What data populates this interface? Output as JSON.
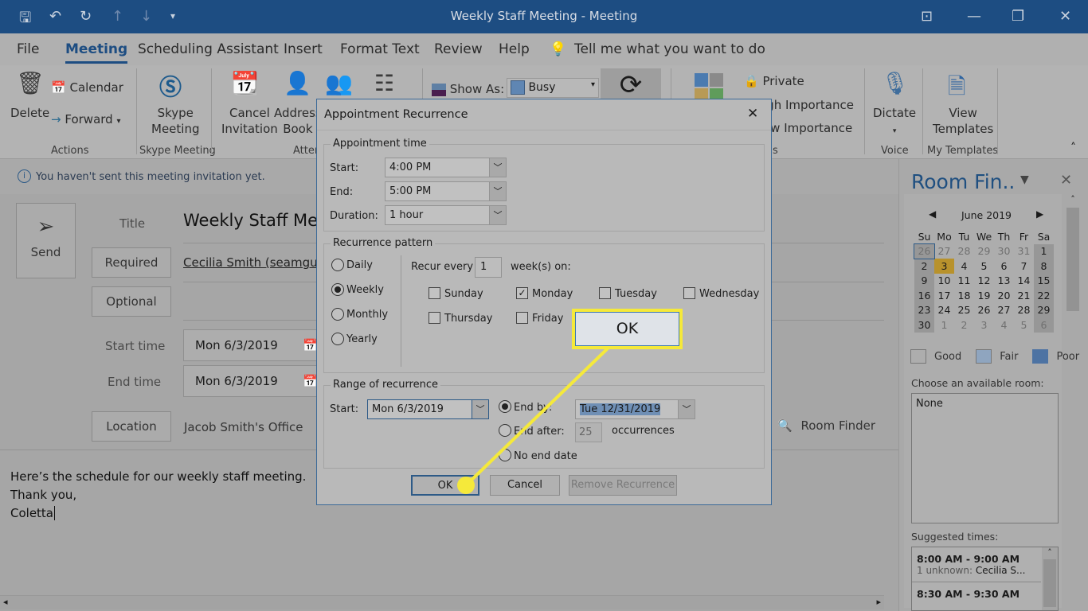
{
  "window": {
    "title": "Weekly Staff Meeting  -  Meeting"
  },
  "menu": [
    "File",
    "Meeting",
    "Scheduling Assistant",
    "Insert",
    "Format Text",
    "Review",
    "Help"
  ],
  "tell_me": "Tell me what you want to do",
  "ribbon": {
    "delete": "Delete",
    "calendar": "Calendar",
    "forward": "Forward",
    "actions": "Actions",
    "skype1": "Skype",
    "skype2": "Meeting",
    "skype_group": "Skype Meeting",
    "cancel1": "Cancel",
    "cancel2": "Invitation",
    "address1": "Address",
    "address2": "Book",
    "attendees_group": "Atten",
    "show_as": "Show As:",
    "busy": "Busy",
    "private": "Private",
    "high": "igh Importance",
    "low": "ow Importance",
    "tags_group": "s",
    "dictate": "Dictate",
    "voice": "Voice",
    "view1": "View",
    "view2": "Templates",
    "my_templates": "My Templates"
  },
  "info": "You haven't sent this meeting invitation yet.",
  "form": {
    "send": "Send",
    "title_label": "Title",
    "title": "Weekly Staff Mee",
    "required": "Required",
    "required_value": "Cecilia Smith (seamguide",
    "optional": "Optional",
    "start_label": "Start time",
    "start": "Mon 6/3/2019",
    "end_label": "End time",
    "end": "Mon 6/3/2019",
    "location": "Location",
    "location_value": "Jacob Smith's Office",
    "room_finder": "Room Finder"
  },
  "body": [
    "Here’s the schedule for our weekly staff meeting.",
    "Thank you,",
    "Coletta"
  ],
  "pane": {
    "title": "Room Fin..",
    "month": "June 2019",
    "days": [
      "Su",
      "Mo",
      "Tu",
      "We",
      "Th",
      "Fr",
      "Sa"
    ],
    "weeks": [
      [
        "26",
        "27",
        "28",
        "29",
        "30",
        "31",
        "1"
      ],
      [
        "2",
        "3",
        "4",
        "5",
        "6",
        "7",
        "8"
      ],
      [
        "9",
        "10",
        "11",
        "12",
        "13",
        "14",
        "15"
      ],
      [
        "16",
        "17",
        "18",
        "19",
        "20",
        "21",
        "22"
      ],
      [
        "23",
        "24",
        "25",
        "26",
        "27",
        "28",
        "29"
      ],
      [
        "30",
        "1",
        "2",
        "3",
        "4",
        "5",
        "6"
      ]
    ],
    "selected_day": "3",
    "legend": [
      "Good",
      "Fair",
      "Poor"
    ],
    "choose": "Choose an available room:",
    "room": "None",
    "suggested": "Suggested times:",
    "times": [
      {
        "time": "8:00 AM - 9:00 AM",
        "note_prefix": "1 unknown:",
        "note": "Cecilia S..."
      },
      {
        "time": "8:30 AM - 9:30 AM"
      }
    ]
  },
  "dialog": {
    "title": "Appointment Recurrence",
    "appt_time": "Appointment time",
    "start_label": "Start:",
    "start": "4:00 PM",
    "end_label": "End:",
    "end": "5:00 PM",
    "duration_label": "Duration:",
    "duration": "1 hour",
    "pattern": "Recurrence pattern",
    "daily": "Daily",
    "weekly": "Weekly",
    "monthly": "Monthly",
    "yearly": "Yearly",
    "selected_pattern": "Weekly",
    "recur_every": "Recur every",
    "recur_value": "1",
    "weeks_on": "week(s) on:",
    "weekdays": [
      {
        "label": "Sunday",
        "checked": false
      },
      {
        "label": "Monday",
        "checked": true
      },
      {
        "label": "Tuesday",
        "checked": false
      },
      {
        "label": "Wednesday",
        "checked": false
      },
      {
        "label": "Thursday",
        "checked": false
      },
      {
        "label": "Friday",
        "checked": false
      }
    ],
    "range": "Range of recurrence",
    "range_start_label": "Start:",
    "range_start": "Mon 6/3/2019",
    "end_by": "End by:",
    "end_by_value": "Tue 12/31/2019",
    "end_after": "End after:",
    "occurrences_value": "25",
    "occurrences": "occurrences",
    "no_end": "No end date",
    "ok": "OK",
    "cancel": "Cancel",
    "remove": "Remove Recurrence"
  },
  "callout": {
    "label": "OK",
    "color": "#f5e93a"
  }
}
